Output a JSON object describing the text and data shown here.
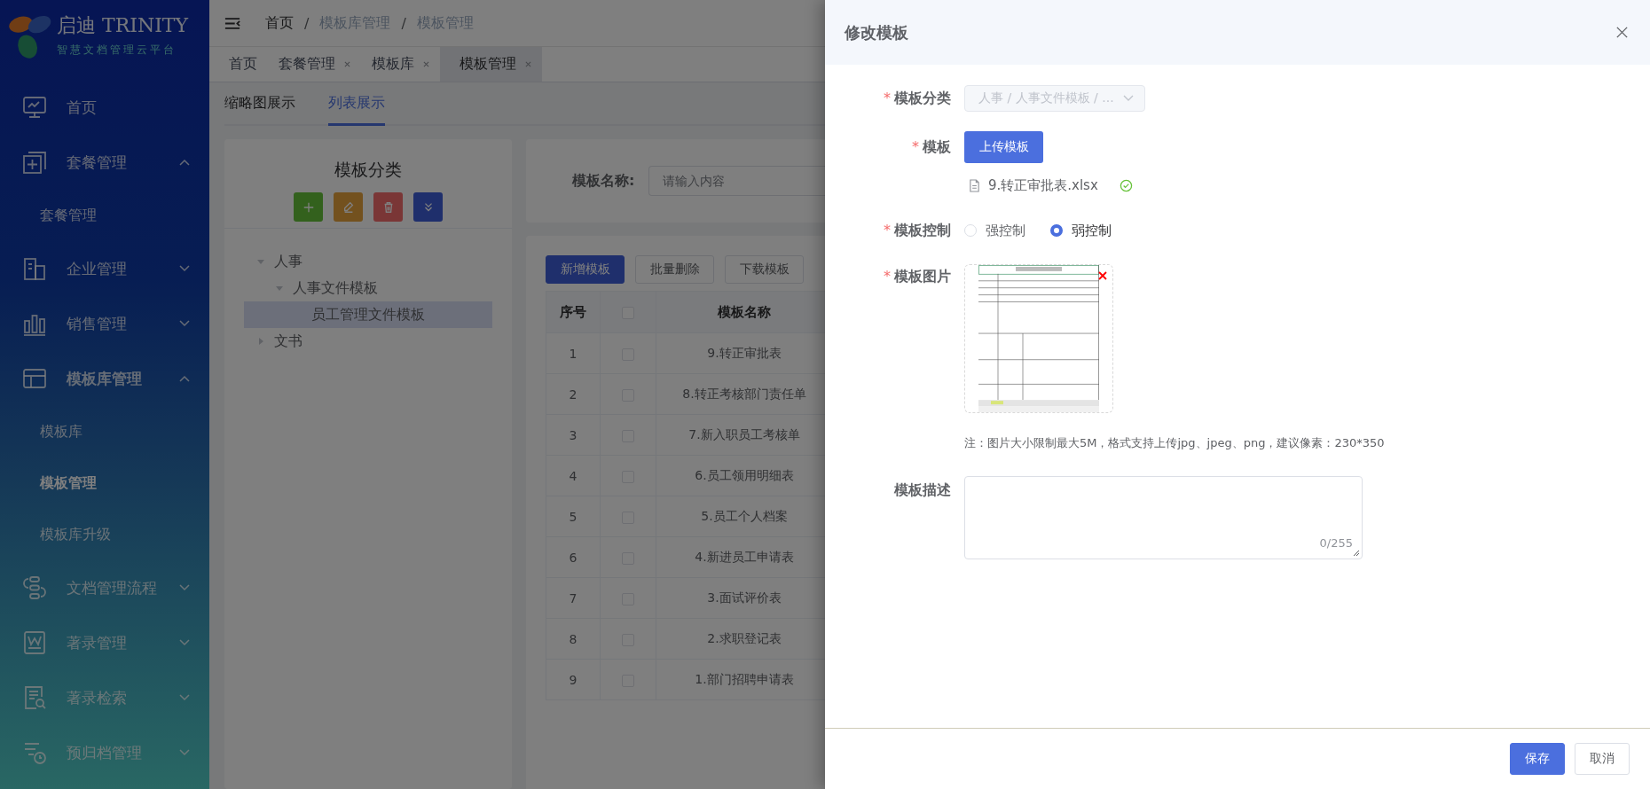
{
  "sidebar": {
    "logo_title": "启迪 TRINITY",
    "logo_subtitle": "智慧文档管理云平台",
    "home_item": {
      "label": "首页"
    },
    "menu": [
      {
        "label": "套餐管理",
        "expanded": true,
        "children": [
          {
            "label": "套餐管理",
            "selected": false
          }
        ]
      },
      {
        "label": "企业管理",
        "expanded": false
      },
      {
        "label": "销售管理",
        "expanded": false
      },
      {
        "label": "模板库管理",
        "expanded": true,
        "children": [
          {
            "label": "模板库",
            "selected": false
          },
          {
            "label": "模板管理",
            "selected": true
          },
          {
            "label": "模板库升级",
            "selected": false
          }
        ]
      },
      {
        "label": "文档管理流程",
        "expanded": false
      },
      {
        "label": "著录管理",
        "expanded": false
      },
      {
        "label": "著录检索",
        "expanded": false
      },
      {
        "label": "预归档管理",
        "expanded": false
      }
    ]
  },
  "breadcrumb": {
    "separator": "/",
    "items": [
      "首页",
      "模板库管理",
      "模板管理"
    ]
  },
  "page_tabs": [
    {
      "label": "首页",
      "closable": false,
      "selected": false
    },
    {
      "label": "套餐管理",
      "closable": true,
      "selected": false
    },
    {
      "label": "模板库",
      "closable": true,
      "selected": false
    },
    {
      "label": "模板管理",
      "closable": true,
      "selected": true
    }
  ],
  "view_tabs": [
    {
      "label": "缩略图展示",
      "selected": false
    },
    {
      "label": "列表展示",
      "selected": true
    }
  ],
  "category_panel": {
    "title": "模板分类",
    "tree": [
      {
        "label": "人事",
        "expanded": true,
        "selected": false,
        "children": [
          {
            "label": "人事文件模板",
            "expanded": true,
            "selected": false,
            "children": [
              {
                "label": "员工管理文件模板",
                "selected": true
              }
            ]
          }
        ]
      },
      {
        "label": "文书",
        "expanded": false,
        "selected": false
      }
    ]
  },
  "search": {
    "label": "模板名称:",
    "placeholder": "请输入内容"
  },
  "toolbar": [
    {
      "label": "新增模板",
      "kind": "primary"
    },
    {
      "label": "批量删除",
      "kind": "default"
    },
    {
      "label": "下载模板",
      "kind": "default"
    }
  ],
  "table": {
    "columns": [
      {
        "kind": "text",
        "label": "序号"
      },
      {
        "kind": "checkbox",
        "checked": false
      },
      {
        "kind": "text",
        "label": "模板名称"
      }
    ],
    "rows": [
      {
        "index": "1",
        "checked": false,
        "name": "9.转正审批表"
      },
      {
        "index": "2",
        "checked": false,
        "name": "8.转正考核部门责任单"
      },
      {
        "index": "3",
        "checked": false,
        "name": "7.新入职员工考核单"
      },
      {
        "index": "4",
        "checked": false,
        "name": "6.员工领用明细表"
      },
      {
        "index": "5",
        "checked": false,
        "name": "5.员工个人档案"
      },
      {
        "index": "6",
        "checked": false,
        "name": "4.新进员工申请表"
      },
      {
        "index": "7",
        "checked": false,
        "name": "3.面试评价表"
      },
      {
        "index": "8",
        "checked": false,
        "name": "2.求职登记表"
      },
      {
        "index": "9",
        "checked": false,
        "name": "1.部门招聘申请表"
      }
    ]
  },
  "drawer": {
    "title": "修改模板",
    "required_mark": "*",
    "fields": [
      {
        "kind": "cascader",
        "label": "模板分类",
        "required": true,
        "value": "人事 / 人事文件模板 / ...",
        "disabled": true
      },
      {
        "kind": "upload",
        "label": "模板",
        "required": true,
        "button": "上传模板",
        "file": {
          "name": "9.转正审批表.xlsx",
          "done": true
        }
      },
      {
        "kind": "radio",
        "label": "模板控制",
        "required": true,
        "options": [
          {
            "label": "强控制",
            "selected": false
          },
          {
            "label": "弱控制",
            "selected": true
          }
        ]
      },
      {
        "label": "模板图片",
        "required": true,
        "note": "注：图片大小限制最大5M，格式支持上传jpg、jpeg、png，建议像素：230*350"
      },
      {
        "kind": "textarea",
        "label": "模板描述",
        "required": false,
        "count": "0/255"
      }
    ],
    "buttons": [
      {
        "label": "保存",
        "kind": "primary"
      },
      {
        "label": "取消",
        "kind": "default"
      }
    ]
  }
}
